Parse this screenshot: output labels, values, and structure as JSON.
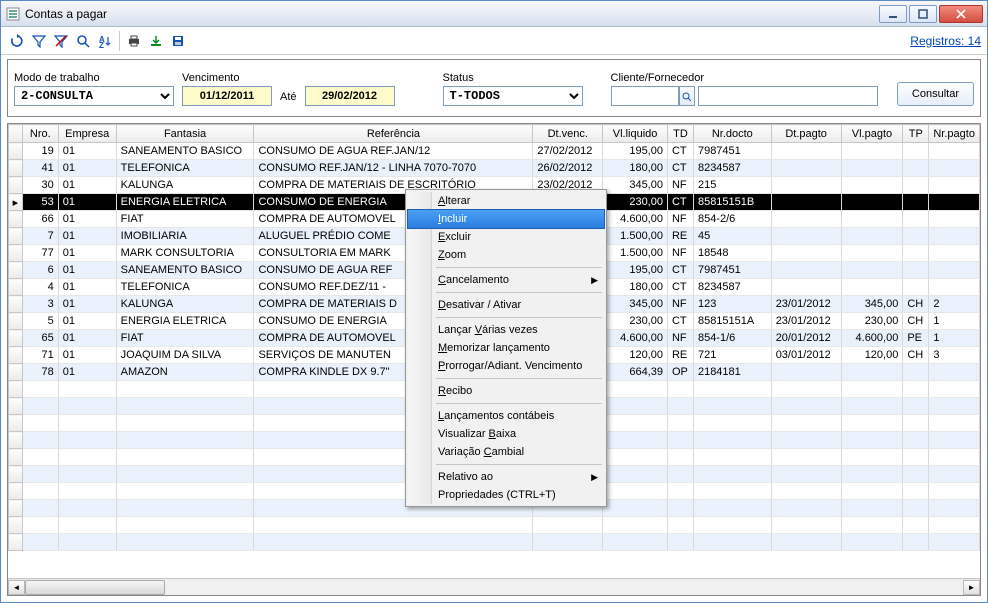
{
  "window": {
    "title": "Contas a pagar"
  },
  "toolbar": {
    "registros_label": "Registros: 14"
  },
  "filters": {
    "modo_label": "Modo de trabalho",
    "modo_value": "2-CONSULTA",
    "venc_label": "Vencimento",
    "venc_from": "01/12/2011",
    "ate_label": "Até",
    "venc_to": "29/02/2012",
    "status_label": "Status",
    "status_value": "T-TODOS",
    "cliente_label": "Cliente/Fornecedor",
    "consultar_label": "Consultar"
  },
  "columns": [
    "Nro.",
    "Empresa",
    "Fantasia",
    "Referência",
    "Dt.venc.",
    "Vl.liquido",
    "TD",
    "Nr.docto",
    "Dt.pagto",
    "Vl.pagto",
    "TP",
    "Nr.pagto"
  ],
  "rows": [
    {
      "nro": "19",
      "empresa": "01",
      "fantasia": "SANEAMENTO BASICO",
      "ref": "CONSUMO DE AGUA REF.JAN/12",
      "dtvenc": "27/02/2012",
      "vlliq": "195,00",
      "td": "CT",
      "nrdoc": "7987451",
      "dtpag": "",
      "vlpag": "",
      "tp": "",
      "nrpag": ""
    },
    {
      "nro": "41",
      "empresa": "01",
      "fantasia": "TELEFONICA",
      "ref": "CONSUMO REF.JAN/12 - LINHA 7070-7070",
      "dtvenc": "26/02/2012",
      "vlliq": "180,00",
      "td": "CT",
      "nrdoc": "8234587",
      "dtpag": "",
      "vlpag": "",
      "tp": "",
      "nrpag": ""
    },
    {
      "nro": "30",
      "empresa": "01",
      "fantasia": "KALUNGA",
      "ref": "COMPRA DE MATERIAIS DE ESCRITÓRIO",
      "dtvenc": "23/02/2012",
      "vlliq": "345,00",
      "td": "NF",
      "nrdoc": "215",
      "dtpag": "",
      "vlpag": "",
      "tp": "",
      "nrpag": ""
    },
    {
      "nro": "53",
      "empresa": "01",
      "fantasia": "ENERGIA ELETRICA",
      "ref": "CONSUMO DE ENERGIA",
      "dtvenc": "",
      "vlliq": "230,00",
      "td": "CT",
      "nrdoc": "85815151B",
      "dtpag": "",
      "vlpag": "",
      "tp": "",
      "nrpag": "",
      "selected": true
    },
    {
      "nro": "66",
      "empresa": "01",
      "fantasia": "FIAT",
      "ref": "COMPRA DE AUTOMOVEL",
      "dtvenc": "",
      "vlliq": "4.600,00",
      "td": "NF",
      "nrdoc": "854-2/6",
      "dtpag": "",
      "vlpag": "",
      "tp": "",
      "nrpag": ""
    },
    {
      "nro": "7",
      "empresa": "01",
      "fantasia": "IMOBILIARIA",
      "ref": "ALUGUEL PRÉDIO COME",
      "dtvenc": "",
      "vlliq": "1.500,00",
      "td": "RE",
      "nrdoc": "45",
      "dtpag": "",
      "vlpag": "",
      "tp": "",
      "nrpag": ""
    },
    {
      "nro": "77",
      "empresa": "01",
      "fantasia": "MARK CONSULTORIA",
      "ref": "CONSULTORIA EM MARK",
      "dtvenc": "",
      "vlliq": "1.500,00",
      "td": "NF",
      "nrdoc": "18548",
      "dtpag": "",
      "vlpag": "",
      "tp": "",
      "nrpag": ""
    },
    {
      "nro": "6",
      "empresa": "01",
      "fantasia": "SANEAMENTO BASICO",
      "ref": "CONSUMO DE AGUA REF",
      "dtvenc": "",
      "vlliq": "195,00",
      "td": "CT",
      "nrdoc": "7987451",
      "dtpag": "",
      "vlpag": "",
      "tp": "",
      "nrpag": ""
    },
    {
      "nro": "4",
      "empresa": "01",
      "fantasia": "TELEFONICA",
      "ref": "CONSUMO REF.DEZ/11 -",
      "dtvenc": "",
      "vlliq": "180,00",
      "td": "CT",
      "nrdoc": "8234587",
      "dtpag": "",
      "vlpag": "",
      "tp": "",
      "nrpag": ""
    },
    {
      "nro": "3",
      "empresa": "01",
      "fantasia": "KALUNGA",
      "ref": "COMPRA DE MATERIAIS D",
      "dtvenc": "",
      "vlliq": "345,00",
      "td": "NF",
      "nrdoc": "123",
      "dtpag": "23/01/2012",
      "vlpag": "345,00",
      "tp": "CH",
      "nrpag": "2"
    },
    {
      "nro": "5",
      "empresa": "01",
      "fantasia": "ENERGIA ELETRICA",
      "ref": "CONSUMO DE ENERGIA",
      "dtvenc": "",
      "vlliq": "230,00",
      "td": "CT",
      "nrdoc": "85815151A",
      "dtpag": "23/01/2012",
      "vlpag": "230,00",
      "tp": "CH",
      "nrpag": "1"
    },
    {
      "nro": "65",
      "empresa": "01",
      "fantasia": "FIAT",
      "ref": "COMPRA DE AUTOMOVEL",
      "dtvenc": "",
      "vlliq": "4.600,00",
      "td": "NF",
      "nrdoc": "854-1/6",
      "dtpag": "20/01/2012",
      "vlpag": "4.600,00",
      "tp": "PE",
      "nrpag": "1"
    },
    {
      "nro": "71",
      "empresa": "01",
      "fantasia": "JOAQUIM DA SILVA",
      "ref": "SERVIÇOS DE MANUTEN",
      "dtvenc": "",
      "vlliq": "120,00",
      "td": "RE",
      "nrdoc": "721",
      "dtpag": "03/01/2012",
      "vlpag": "120,00",
      "tp": "CH",
      "nrpag": "3"
    },
    {
      "nro": "78",
      "empresa": "01",
      "fantasia": "AMAZON",
      "ref": "COMPRA KINDLE DX 9.7\"",
      "dtvenc": "",
      "vlliq": "664,39",
      "td": "OP",
      "nrdoc": "2184181",
      "dtpag": "",
      "vlpag": "",
      "tp": "",
      "nrpag": ""
    }
  ],
  "context_menu": {
    "alterar": "Alterar",
    "incluir": "Incluir",
    "excluir": "Excluir",
    "zoom": "Zoom",
    "cancelamento": "Cancelamento",
    "desativar": "Desativar / Ativar",
    "lancar": "Lançar Várias vezes",
    "memorizar": "Memorizar lançamento",
    "prorrogar": "Prorrogar/Adiant. Vencimento",
    "recibo": "Recibo",
    "lanc_cont": "Lançamentos contábeis",
    "vis_baixa": "Visualizar Baixa",
    "var_cambial": "Variação Cambial",
    "relativo": "Relativo ao",
    "props": "Propriedades (CTRL+T)"
  }
}
